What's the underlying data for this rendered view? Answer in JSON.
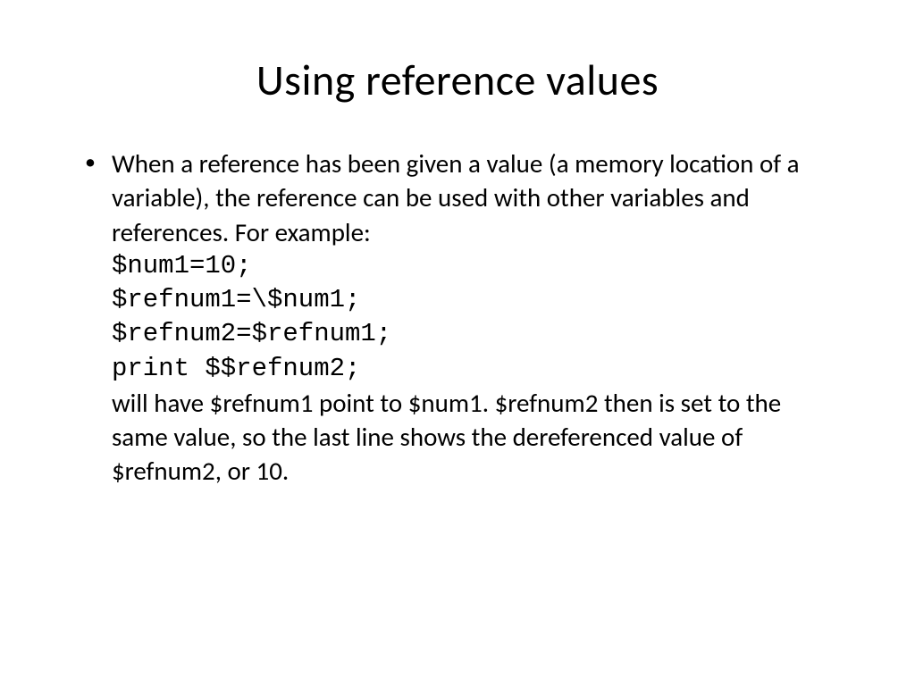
{
  "title": "Using reference values",
  "bullet": {
    "marker": "•",
    "intro": "When a reference has been given a value (a memory location of a variable), the reference can be used with other variables and references.  For example:",
    "code1": "$num1=10;",
    "code2": "$refnum1=\\$num1;",
    "code3": "$refnum2=$refnum1;",
    "code4": "print $$refnum2;",
    "outro": "will have $refnum1 point to $num1. $refnum2 then is set to the same value, so the last line shows the dereferenced value of $refnum2, or 10."
  }
}
